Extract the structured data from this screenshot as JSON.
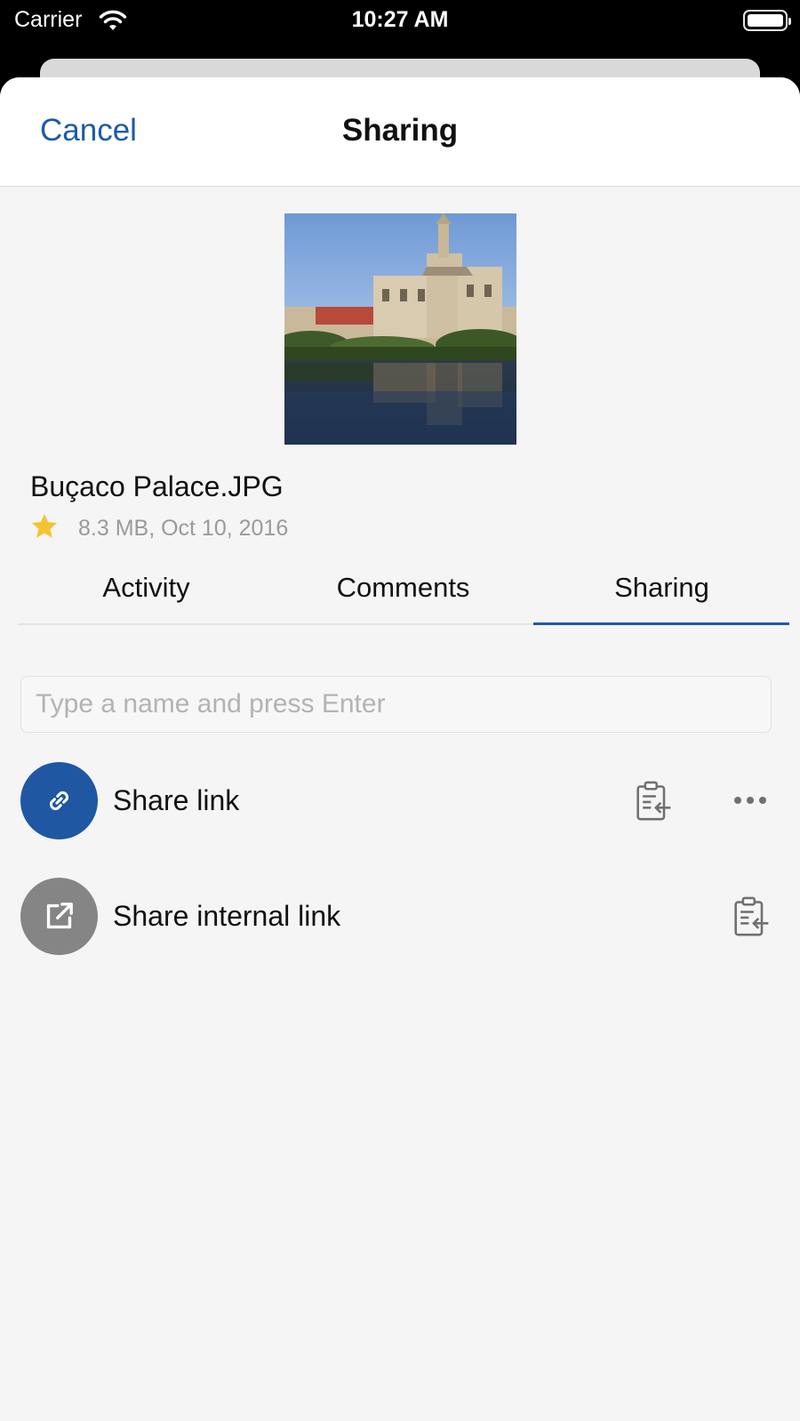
{
  "status_bar": {
    "carrier": "Carrier",
    "time": "10:27 AM"
  },
  "nav": {
    "cancel_label": "Cancel",
    "title": "Sharing"
  },
  "file": {
    "name": "Buçaco Palace.JPG",
    "meta": "8.3 MB, Oct 10, 2016",
    "favorite": true,
    "thumbnail_icon": "photo-thumbnail"
  },
  "tabs": [
    {
      "label": "Activity",
      "active": false
    },
    {
      "label": "Comments",
      "active": false
    },
    {
      "label": "Sharing",
      "active": true
    }
  ],
  "search": {
    "placeholder": "Type a name and press Enter",
    "value": ""
  },
  "share_rows": [
    {
      "label": "Share link",
      "icon": "link-icon",
      "actions": [
        "copy-icon",
        "more-icon"
      ]
    },
    {
      "label": "Share internal link",
      "icon": "external-link-icon",
      "actions": [
        "copy-icon"
      ]
    }
  ],
  "colors": {
    "accent": "#1e5aa8",
    "link_avatar": "#1f57a3",
    "internal_avatar": "#858585",
    "star": "#f4c430"
  }
}
